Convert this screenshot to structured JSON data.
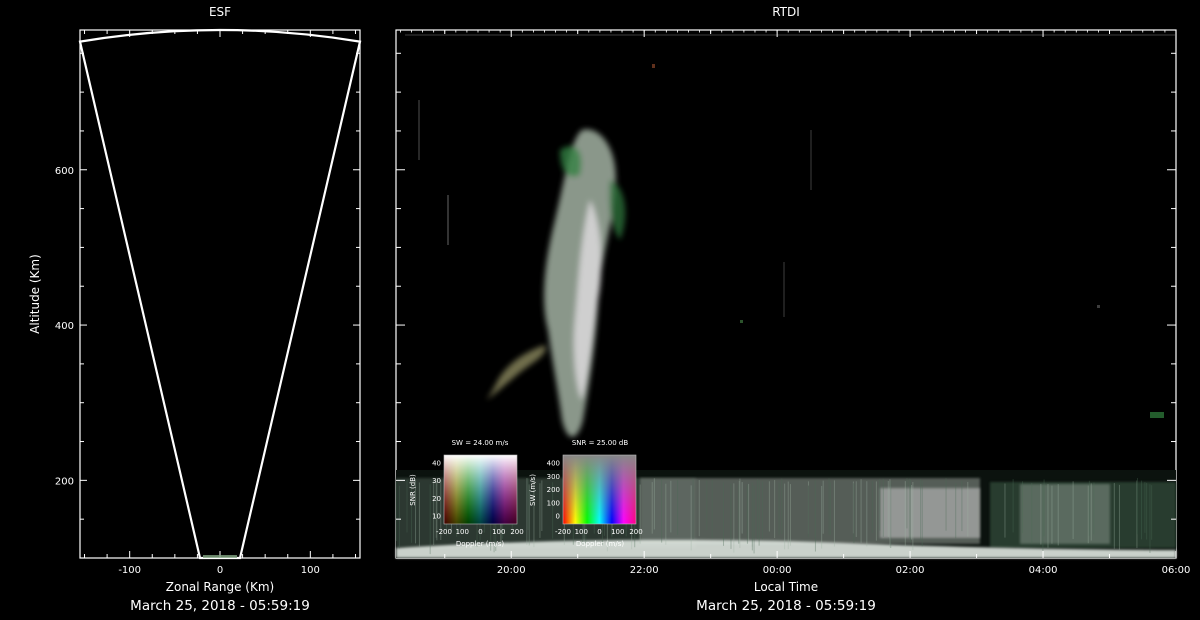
{
  "chart_data": [
    {
      "type": "scatter",
      "title": "ESF",
      "xlabel": "Zonal Range (Km)",
      "ylabel": "Altitude (Km)",
      "date_label": "March 25, 2018 - 05:59:19",
      "xlim": [
        -155,
        155
      ],
      "ylim": [
        100,
        780
      ],
      "x_ticks": [
        -100,
        0,
        100
      ],
      "x_tick_labels": [
        "-100",
        "0",
        "100"
      ],
      "y_ticks": [
        200,
        400,
        600
      ],
      "y_tick_labels": [
        "200",
        "400",
        "600"
      ],
      "grid": false,
      "beam_fan": {
        "apex": [
          0,
          100
        ],
        "left_top": [
          -155,
          765
        ],
        "right_top": [
          155,
          765
        ],
        "arc_top": 780
      }
    },
    {
      "type": "heatmap",
      "title": "RTDI",
      "xlabel": "Local Time",
      "ylabel": "",
      "date_label": "March 25, 2018 - 05:59:19",
      "x_tick_labels": [
        "20:00",
        "22:00",
        "00:00",
        "02:00",
        "04:00",
        "06:00"
      ],
      "y_tick_labels": [],
      "xlim": [
        "18:16",
        "06:00"
      ],
      "ylim": [
        100,
        780
      ],
      "grid": false,
      "colorbar_sw": {
        "title": "SW = 24.00 m/s",
        "xlabel": "Doppler (m/s)",
        "ylabel": "SNR (dB)",
        "x_tick_labels": [
          "-200",
          "100",
          "0",
          "100",
          "200"
        ],
        "y_tick_labels": [
          "40",
          "30",
          "20",
          "10"
        ]
      },
      "colorbar_snr": {
        "title": "SNR = 25.00 dB",
        "xlabel": "Doppler (m/s)",
        "ylabel": "SW (m/s)",
        "x_tick_labels": [
          "-200",
          "100",
          "0",
          "100",
          "200"
        ],
        "y_tick_labels": [
          "400",
          "300",
          "200",
          "100",
          "0"
        ]
      }
    }
  ]
}
